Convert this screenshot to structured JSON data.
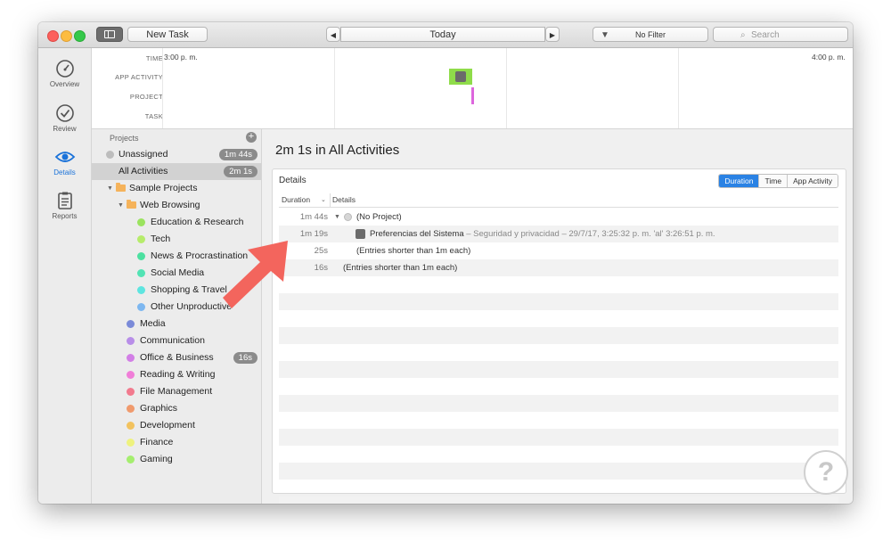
{
  "toolbar": {
    "new_task": "New Task",
    "date": "Today",
    "filter": "No Filter",
    "search_placeholder": "Search",
    "prev_icon": "◀",
    "next_icon": "▶"
  },
  "iconbar": {
    "items": [
      {
        "label": "Overview",
        "icon": "speedometer-icon"
      },
      {
        "label": "Review",
        "icon": "checkmark-icon"
      },
      {
        "label": "Details",
        "icon": "eye-icon"
      },
      {
        "label": "Reports",
        "icon": "clipboard-icon"
      }
    ]
  },
  "timeline": {
    "labels": {
      "time": "TIME",
      "app_activity": "APP ACTIVITY",
      "project": "PROJECT",
      "task": "TASK"
    },
    "start_time": "3:00 p. m.",
    "end_time": "4:00 p. m."
  },
  "projects": {
    "header": "Projects",
    "items": [
      {
        "label": "Unassigned",
        "badge": "1m 44s",
        "color": "#bdbdbd"
      },
      {
        "label": "All Activities",
        "badge": "2m 1s"
      },
      {
        "label": "Sample Projects"
      },
      {
        "label": "Web Browsing"
      },
      {
        "label": "Education & Research",
        "color": "#9be35f"
      },
      {
        "label": "Tech",
        "color": "#b6ec6b"
      },
      {
        "label": "News & Procrastination",
        "color": "#4ce0a0"
      },
      {
        "label": "Social Media",
        "color": "#52e3b4"
      },
      {
        "label": "Shopping & Travel",
        "color": "#5ee5e0"
      },
      {
        "label": "Other Unproductive",
        "color": "#7db7f0"
      },
      {
        "label": "Media",
        "color": "#7a8ad8"
      },
      {
        "label": "Communication",
        "color": "#b88ee8"
      },
      {
        "label": "Office & Business",
        "badge": "16s",
        "color": "#d27fe6"
      },
      {
        "label": "Reading & Writing",
        "color": "#f07ed8"
      },
      {
        "label": "File Management",
        "color": "#f27a8e"
      },
      {
        "label": "Graphics",
        "color": "#f09a6d"
      },
      {
        "label": "Development",
        "color": "#f2c25e"
      },
      {
        "label": "Finance",
        "color": "#eef27e"
      },
      {
        "label": "Gaming",
        "color": "#a5ee6f"
      }
    ]
  },
  "main": {
    "title": "2m 1s in All Activities",
    "panel_title": "Details",
    "segments": [
      "Duration",
      "Time",
      "App Activity"
    ],
    "columns": {
      "duration": "Duration",
      "details": "Details"
    },
    "rows": [
      {
        "duration": "1m 44s",
        "text": "(No Project)"
      },
      {
        "duration": "1m 19s",
        "app": "Preferencias del Sistema",
        "info": "– Seguridad y privacidad – 29/7/17, 3:25:32 p. m. 'al' 3:26:51 p. m."
      },
      {
        "duration": "25s",
        "text": "(Entries shorter than 1m each)"
      },
      {
        "duration": "16s",
        "text": "(Entries shorter than 1m each)"
      }
    ]
  }
}
